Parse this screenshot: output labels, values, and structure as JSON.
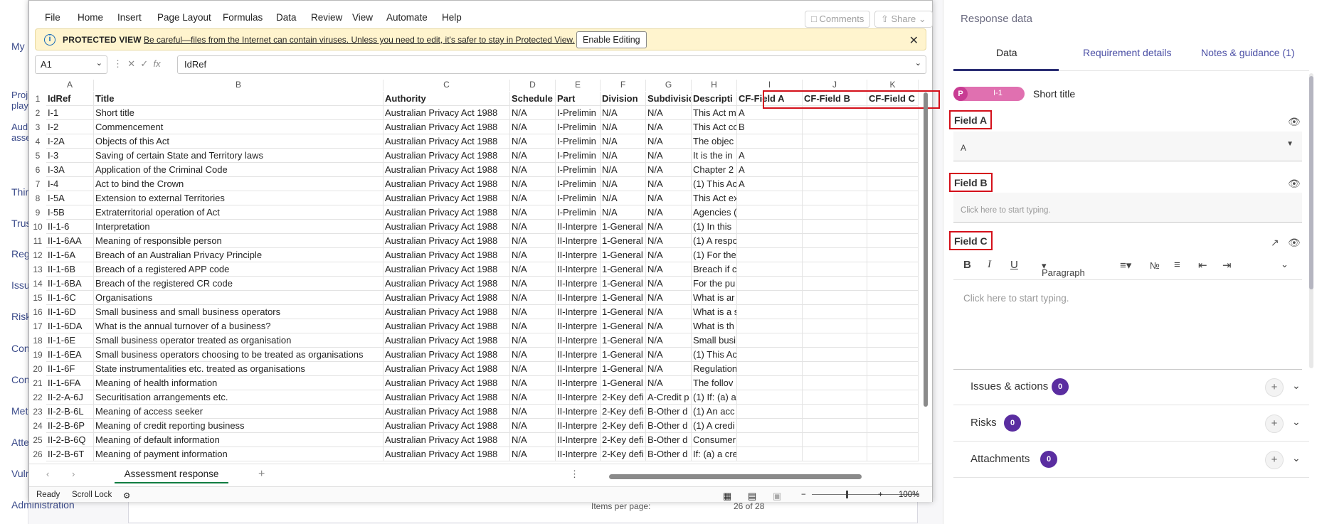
{
  "background": {
    "nav_items": [
      "My",
      "Proj",
      "play",
      "Aud",
      "asse",
      "Thir",
      "Trus",
      "Reg",
      "Issu",
      "Risk",
      "Con",
      "Con",
      "Met",
      "Atte",
      "Vuln",
      "Administration"
    ],
    "footer": {
      "items_per_page": "Items per page:",
      "range": "26 of 28"
    }
  },
  "excel": {
    "menu": [
      "File",
      "Home",
      "Insert",
      "Page Layout",
      "Formulas",
      "Data",
      "Review",
      "View",
      "Automate",
      "Help"
    ],
    "comments_btn": "Comments",
    "share_btn": "Share",
    "protected": {
      "title": "PROTECTED VIEW",
      "message": "Be careful—files from the Internet can contain viruses. Unless you need to edit, it's safer to stay in Protected View.",
      "enable_btn": "Enable Editing",
      "close": "✕"
    },
    "namebox": "A1",
    "formula_value": "IdRef",
    "columns": [
      "A",
      "B",
      "C",
      "D",
      "E",
      "F",
      "G",
      "H",
      "I",
      "J",
      "K"
    ],
    "rows": [
      [
        "IdRef",
        "Title",
        "Authority",
        "Schedule",
        "Part",
        "Division",
        "Subdivisio",
        "Descripti",
        "CF-Field A",
        "CF-Field B",
        "CF-Field C"
      ],
      [
        "I-1",
        "Short title",
        "Australian Privacy Act 1988",
        "N/A",
        "I-Prelimin",
        "N/A",
        "N/A",
        "This Act m",
        "A",
        "",
        ""
      ],
      [
        "I-2",
        "Commencement",
        "Australian Privacy Act 1988",
        "N/A",
        "I-Prelimin",
        "N/A",
        "N/A",
        "This Act co",
        "B",
        "",
        ""
      ],
      [
        "I-2A",
        "Objects of this Act",
        "Australian Privacy Act 1988",
        "N/A",
        "I-Prelimin",
        "N/A",
        "N/A",
        "The objec",
        "",
        "",
        ""
      ],
      [
        "I-3",
        "Saving of certain State and Territory laws",
        "Australian Privacy Act 1988",
        "N/A",
        "I-Prelimin",
        "N/A",
        "N/A",
        "It is the in",
        "A",
        "",
        ""
      ],
      [
        "I-3A",
        "Application of the Criminal Code",
        "Australian Privacy Act 1988",
        "N/A",
        "I-Prelimin",
        "N/A",
        "N/A",
        "Chapter 2",
        "A",
        "",
        ""
      ],
      [
        "I-4",
        "Act to bind the Crown",
        "Australian Privacy Act 1988",
        "N/A",
        "I-Prelimin",
        "N/A",
        "N/A",
        "(1) This Ac",
        "A",
        "",
        ""
      ],
      [
        "I-5A",
        "Extension to external Territories",
        "Australian Privacy Act 1988",
        "N/A",
        "I-Prelimin",
        "N/A",
        "N/A",
        "This Act ex",
        "",
        "",
        ""
      ],
      [
        "I-5B",
        "Extraterritorial operation of Act",
        "Australian Privacy Act 1988",
        "N/A",
        "I-Prelimin",
        "N/A",
        "N/A",
        "Agencies (",
        "",
        "",
        ""
      ],
      [
        "II-1-6",
        "Interpretation",
        "Australian Privacy Act 1988",
        "N/A",
        "II-Interpre",
        "1-General",
        "N/A",
        "(1) In this",
        "",
        "",
        ""
      ],
      [
        "II-1-6AA",
        "Meaning of responsible person",
        "Australian Privacy Act 1988",
        "N/A",
        "II-Interpre",
        "1-General",
        "N/A",
        "(1) A respo",
        "",
        "",
        ""
      ],
      [
        "II-1-6A",
        "Breach of an Australian Privacy Principle",
        "Australian Privacy Act 1988",
        "N/A",
        "II-Interpre",
        "1-General",
        "N/A",
        "(1) For the",
        "",
        "",
        ""
      ],
      [
        "II-1-6B",
        "Breach of a registered APP code",
        "Australian Privacy Act 1988",
        "N/A",
        "II-Interpre",
        "1-General",
        "N/A",
        "Breach if c",
        "",
        "",
        ""
      ],
      [
        "II-1-6BA",
        "Breach of the registered CR code",
        "Australian Privacy Act 1988",
        "N/A",
        "II-Interpre",
        "1-General",
        "N/A",
        "For the pu",
        "",
        "",
        ""
      ],
      [
        "II-1-6C",
        "Organisations",
        "Australian Privacy Act 1988",
        "N/A",
        "II-Interpre",
        "1-General",
        "N/A",
        "What is ar",
        "",
        "",
        ""
      ],
      [
        "II-1-6D",
        "Small business and small business operators",
        "Australian Privacy Act 1988",
        "N/A",
        "II-Interpre",
        "1-General",
        "N/A",
        "What is a s",
        "",
        "",
        ""
      ],
      [
        "II-1-6DA",
        "What is the annual turnover of a business?",
        "Australian Privacy Act 1988",
        "N/A",
        "II-Interpre",
        "1-General",
        "N/A",
        "What is th",
        "",
        "",
        ""
      ],
      [
        "II-1-6E",
        "Small business operator treated as organisation",
        "Australian Privacy Act 1988",
        "N/A",
        "II-Interpre",
        "1-General",
        "N/A",
        "Small busi",
        "",
        "",
        ""
      ],
      [
        "II-1-6EA",
        "Small business operators choosing to be treated as organisations",
        "Australian Privacy Act 1988",
        "N/A",
        "II-Interpre",
        "1-General",
        "N/A",
        "(1) This Ac",
        "",
        "",
        ""
      ],
      [
        "II-1-6F",
        "State instrumentalities etc. treated as organisations",
        "Australian Privacy Act 1988",
        "N/A",
        "II-Interpre",
        "1-General",
        "N/A",
        "Regulation",
        "",
        "",
        ""
      ],
      [
        "II-1-6FA",
        "Meaning of health information",
        "Australian Privacy Act 1988",
        "N/A",
        "II-Interpre",
        "1-General",
        "N/A",
        "The follov",
        "",
        "",
        ""
      ],
      [
        "II-2-A-6J",
        "Securitisation arrangements etc.",
        "Australian Privacy Act 1988",
        "N/A",
        "II-Interpre",
        "2-Key defi",
        "A-Credit p",
        "(1) If: (a) a",
        "",
        "",
        ""
      ],
      [
        "II-2-B-6L",
        "Meaning of access seeker",
        "Australian Privacy Act 1988",
        "N/A",
        "II-Interpre",
        "2-Key defi",
        "B-Other d",
        "(1) An acc",
        "",
        "",
        ""
      ],
      [
        "II-2-B-6P",
        "Meaning of credit reporting business",
        "Australian Privacy Act 1988",
        "N/A",
        "II-Interpre",
        "2-Key defi",
        "B-Other d",
        "(1) A credi",
        "",
        "",
        ""
      ],
      [
        "II-2-B-6Q",
        "Meaning of default information",
        "Australian Privacy Act 1988",
        "N/A",
        "II-Interpre",
        "2-Key defi",
        "B-Other d",
        "Consumer",
        "",
        "",
        ""
      ],
      [
        "II-2-B-6T",
        "Meaning of payment information",
        "Australian Privacy Act 1988",
        "N/A",
        "II-Interpre",
        "2-Key defi",
        "B-Other d",
        "If: (a) a cre",
        "",
        "",
        ""
      ]
    ],
    "sheet_tab": "Assessment response",
    "status": {
      "ready": "Ready",
      "scroll_lock": "Scroll Lock",
      "zoom": "100%"
    }
  },
  "panel": {
    "title": "Response data",
    "tabs": [
      "Data",
      "Requirement details",
      "Notes & guidance (1)"
    ],
    "pill_letter": "P",
    "pill_id": "I-1",
    "short_title": "Short title",
    "field_a": {
      "label": "Field A",
      "value": "A"
    },
    "field_b": {
      "label": "Field B",
      "placeholder": "Click here to start typing."
    },
    "field_c": {
      "label": "Field C",
      "paragraph": "Paragraph",
      "placeholder": "Click here to start typing."
    },
    "sections": [
      {
        "label": "Issues & actions",
        "count": "0"
      },
      {
        "label": "Risks",
        "count": "0"
      },
      {
        "label": "Attachments",
        "count": "0"
      }
    ],
    "accent": "#5a2da0",
    "highlight": "#d4101a"
  }
}
